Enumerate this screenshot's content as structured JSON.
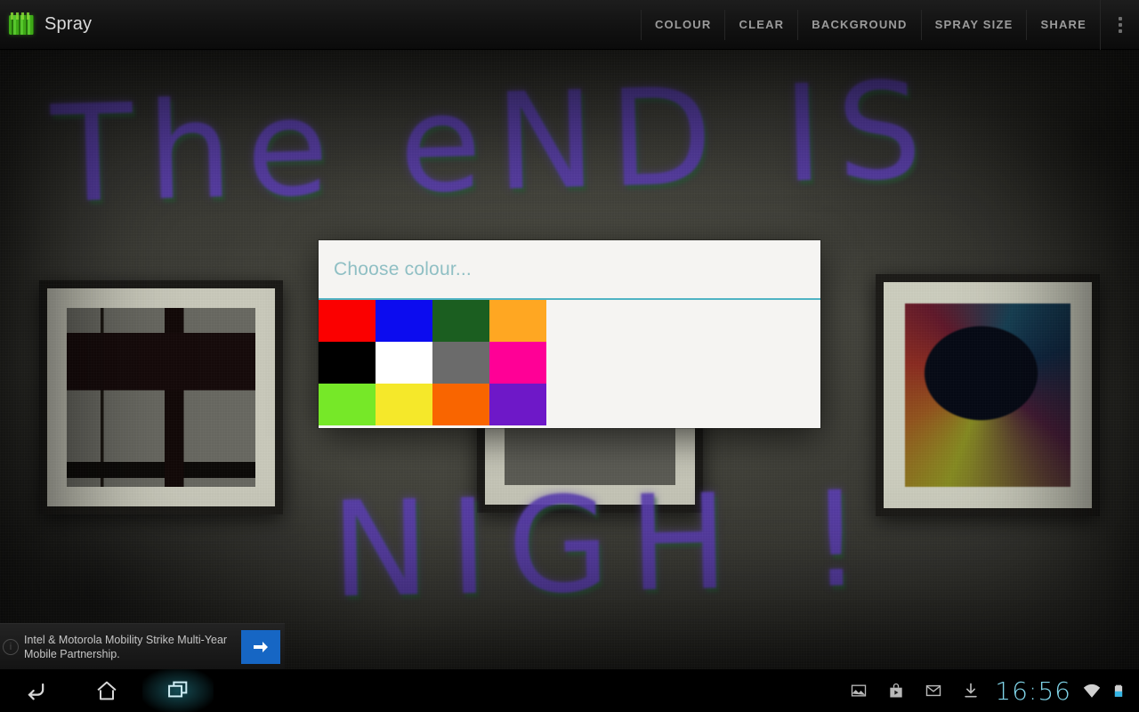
{
  "app": {
    "title": "Spray",
    "icon": "spray-can-icon"
  },
  "action_bar": {
    "items": [
      {
        "label": "COLOUR",
        "name": "colour"
      },
      {
        "label": "CLEAR",
        "name": "clear"
      },
      {
        "label": "BACKGROUND",
        "name": "background"
      },
      {
        "label": "SPRAY SIZE",
        "name": "spray-size"
      },
      {
        "label": "SHARE",
        "name": "share"
      }
    ],
    "overflow": "overflow-menu-icon"
  },
  "canvas": {
    "graffiti_top": "The eND IS",
    "graffiti_bottom": "NIGH !",
    "spray_color": "#5b3fb0",
    "spray_shadow_color": "#1e5f28",
    "wall_color": "#3c3c36"
  },
  "dialog": {
    "title": "Choose colour...",
    "title_color": "#8fbfc4",
    "divider_color": "#4fb3c4",
    "background": "#f5f4f2",
    "swatches": [
      {
        "name": "red",
        "hex": "#FB0000"
      },
      {
        "name": "blue",
        "hex": "#0C0CEF"
      },
      {
        "name": "dark-green",
        "hex": "#1B5E20"
      },
      {
        "name": "orange",
        "hex": "#FFA722"
      },
      {
        "name": "black",
        "hex": "#000000"
      },
      {
        "name": "white",
        "hex": "#FFFFFF"
      },
      {
        "name": "grey",
        "hex": "#6B6B6B"
      },
      {
        "name": "magenta",
        "hex": "#FF0096"
      },
      {
        "name": "lime",
        "hex": "#76E828"
      },
      {
        "name": "yellow",
        "hex": "#F5E82A"
      },
      {
        "name": "orange-red",
        "hex": "#F96500"
      },
      {
        "name": "purple",
        "hex": "#6E18C8"
      }
    ]
  },
  "ad": {
    "text": "Intel & Motorola Mobility Strike Multi-Year Mobile Partnership.",
    "cta": "arrow-right-icon",
    "info": "i",
    "cta_color": "#1666c4"
  },
  "nav_bar": {
    "back": "back-icon",
    "home": "home-icon",
    "recents": "recents-icon",
    "highlight_color": "#33b5c8"
  },
  "status_bar": {
    "icons": [
      {
        "name": "gallery-icon"
      },
      {
        "name": "play-store-icon"
      },
      {
        "name": "gmail-icon"
      },
      {
        "name": "download-icon"
      }
    ],
    "clock": "16:56",
    "clock_color": "#7fd4e8",
    "wifi": "wifi-icon",
    "battery": "battery-icon"
  }
}
